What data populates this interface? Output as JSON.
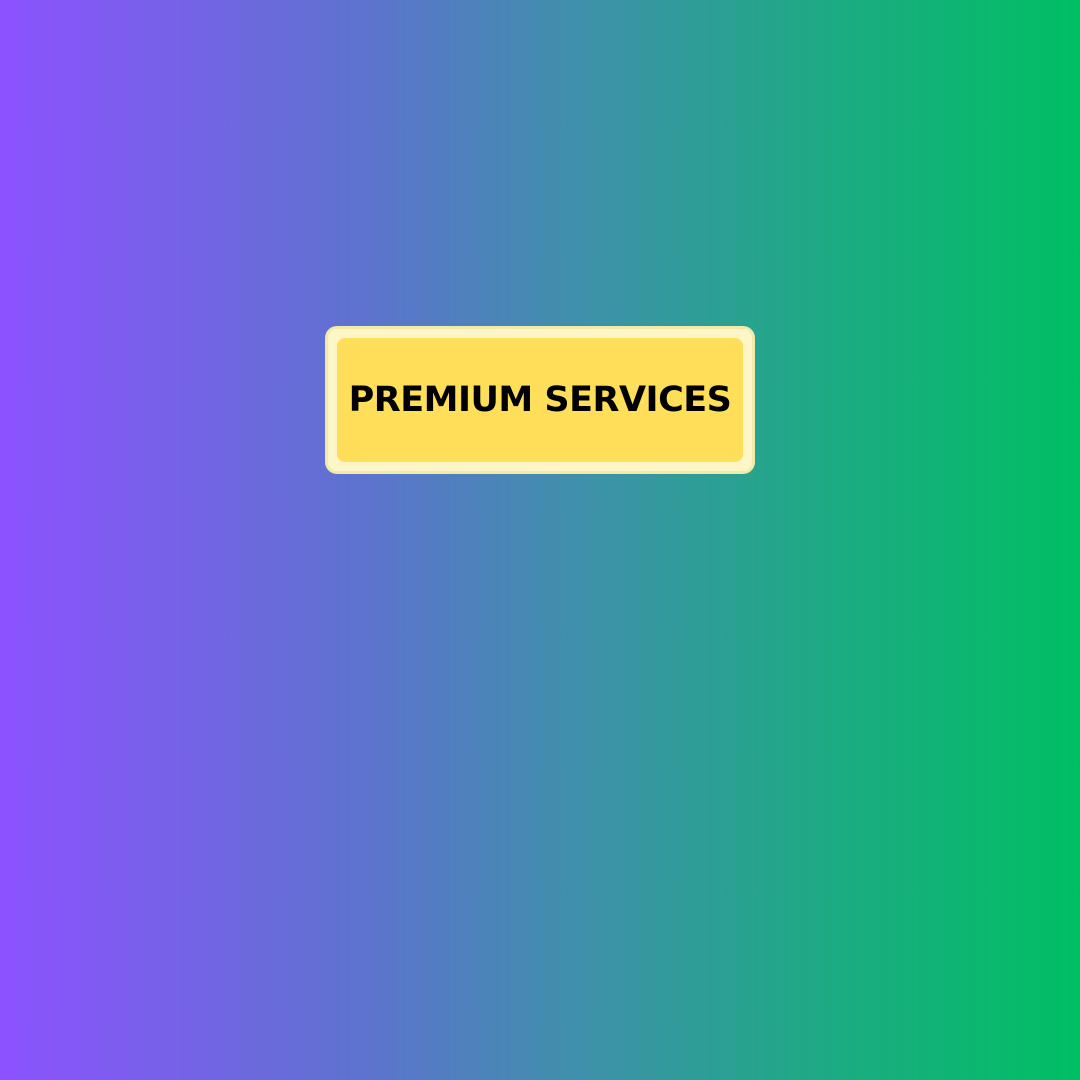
{
  "badge": {
    "label": "PREMIUM SERVICES"
  },
  "colors": {
    "gradient_start": "#8c52ff",
    "gradient_end": "#00bf63",
    "badge_fill": "#ffde59",
    "badge_border": "#fff6c8",
    "text": "#000000"
  }
}
